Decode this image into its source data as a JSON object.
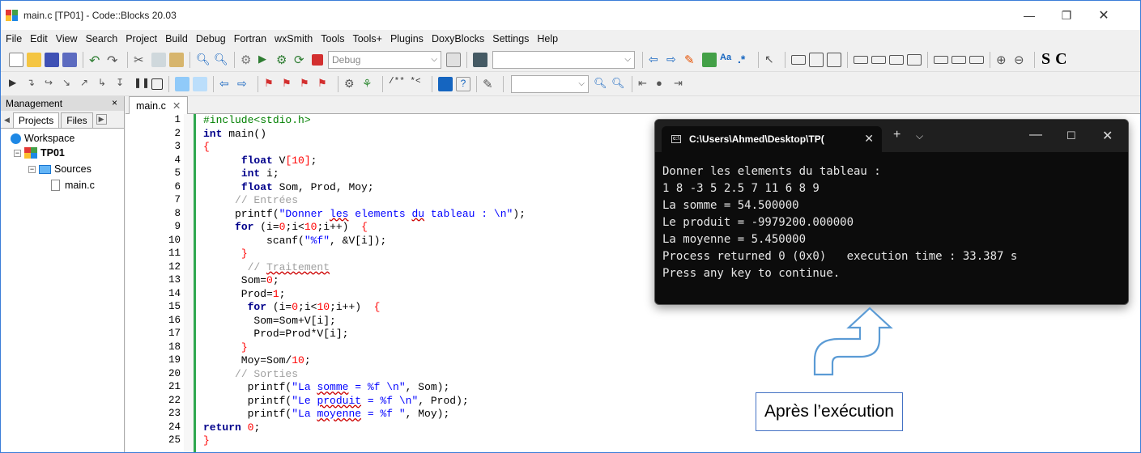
{
  "window": {
    "title": "main.c [TP01] - Code::Blocks 20.03"
  },
  "menu": [
    "File",
    "Edit",
    "View",
    "Search",
    "Project",
    "Build",
    "Debug",
    "Fortran",
    "wxSmith",
    "Tools",
    "Tools+",
    "Plugins",
    "DoxyBlocks",
    "Settings",
    "Help"
  ],
  "toolbar": {
    "build_target": "Debug",
    "comment_label": "/** *<",
    "bold_s": "S",
    "bold_c": "C"
  },
  "management": {
    "title": "Management",
    "close": "×",
    "tabs": [
      "Projects",
      "Files"
    ],
    "workspace": "Workspace",
    "project": "TP01",
    "folder": "Sources",
    "file": "main.c"
  },
  "editor": {
    "tab_label": "main.c",
    "tab_close": "✕",
    "line_numbers": [
      "1",
      "2",
      "3",
      "4",
      "5",
      "6",
      "7",
      "8",
      "9",
      "10",
      "11",
      "12",
      "13",
      "14",
      "15",
      "16",
      "17",
      "18",
      "19",
      "20",
      "21",
      "22",
      "23",
      "24",
      "25"
    ]
  },
  "terminal": {
    "tab_title": "C:\\Users\\Ahmed\\Desktop\\TP(",
    "lines": [
      "Donner les elements du tableau :",
      "1 8 -3 5 2.5 7 11 6 8 9",
      "La somme = 54.500000",
      "Le produit = -9979200.000000",
      "La moyenne = 5.450000",
      "Process returned 0 (0x0)   execution time : 33.387 s",
      "Press any key to continue."
    ]
  },
  "callout": {
    "text": "Après l’exécution"
  },
  "colors": {
    "accent": "#4472c4",
    "keyword": "#00008b",
    "string": "#0000ff",
    "number": "#ff0000",
    "preprocessor": "#008000",
    "comment": "#a0a0a0",
    "terminal_bg": "#0c0c0c"
  }
}
